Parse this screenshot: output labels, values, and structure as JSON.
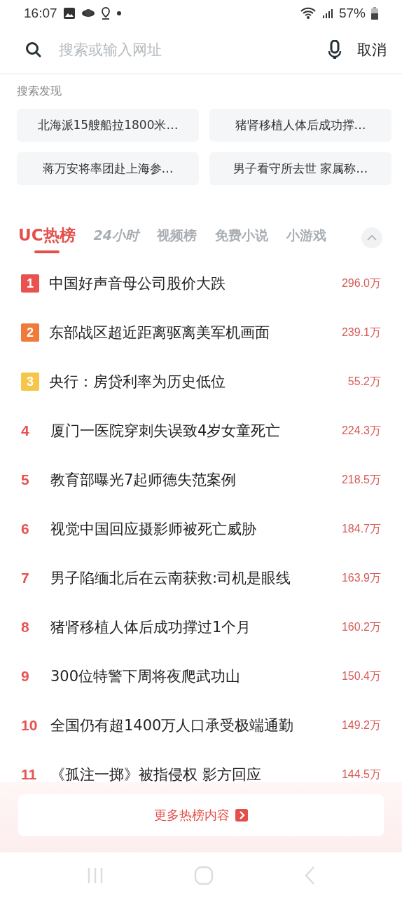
{
  "status_bar": {
    "time": "16:07",
    "battery": "57%"
  },
  "search": {
    "placeholder": "搜索或输入网址",
    "cancel": "取消"
  },
  "discover": {
    "title": "搜索发现",
    "chips": [
      "北海派15艘船拉1800米…",
      "猪肾移植人体后成功撑…",
      "蒋万安将率团赴上海参…",
      "男子看守所去世 家属称…"
    ]
  },
  "tabs": [
    {
      "label": "UC热榜",
      "selected": true,
      "kind": "plain"
    },
    {
      "label": "24小时",
      "selected": false,
      "kind": "italic"
    },
    {
      "label": "视频榜",
      "selected": false,
      "kind": "plain"
    },
    {
      "label": "免费小说",
      "selected": false,
      "kind": "plain"
    },
    {
      "label": "小游戏",
      "selected": false,
      "kind": "plain"
    }
  ],
  "hot_list": [
    {
      "rank": "1",
      "title": "中国好声音母公司股价大跌",
      "heat": "296.0万",
      "kind": "badge",
      "color": "#e8534f"
    },
    {
      "rank": "2",
      "title": "东部战区超近距离驱离美军机画面",
      "heat": "239.1万",
      "kind": "badge",
      "color": "#f07a3a"
    },
    {
      "rank": "3",
      "title": "央行：房贷利率为历史低位",
      "heat": "55.2万",
      "kind": "badge",
      "color": "#f5c64a"
    },
    {
      "rank": "4",
      "title": "厦门一医院穿刺失误致4岁女童死亡",
      "heat": "224.3万",
      "kind": "number"
    },
    {
      "rank": "5",
      "title": "教育部曝光7起师德失范案例",
      "heat": "218.5万",
      "kind": "number"
    },
    {
      "rank": "6",
      "title": "视觉中国回应摄影师被死亡威胁",
      "heat": "184.7万",
      "kind": "number"
    },
    {
      "rank": "7",
      "title": "男子陷缅北后在云南获救:司机是眼线",
      "heat": "163.9万",
      "kind": "number"
    },
    {
      "rank": "8",
      "title": "猪肾移植人体后成功撑过1个月",
      "heat": "160.2万",
      "kind": "number"
    },
    {
      "rank": "9",
      "title": "300位特警下周将夜爬武功山",
      "heat": "150.4万",
      "kind": "number"
    },
    {
      "rank": "10",
      "title": "全国仍有超1400万人口承受极端通勤",
      "heat": "149.2万",
      "kind": "number"
    },
    {
      "rank": "11",
      "title": "《孤注一掷》被指侵权 影方回应",
      "heat": "144.5万",
      "kind": "number"
    }
  ],
  "more_button": "更多热榜内容"
}
